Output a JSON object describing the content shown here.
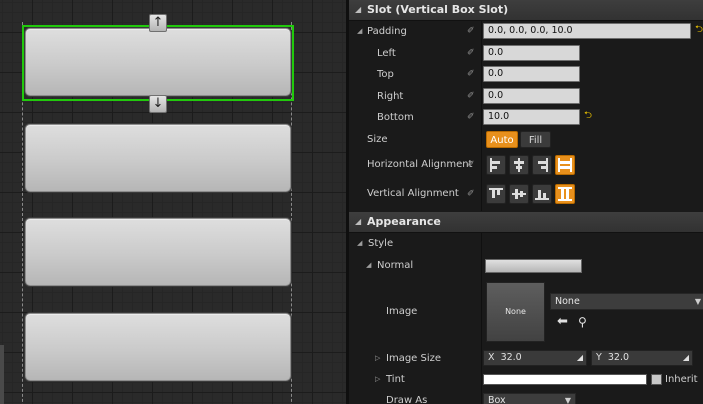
{
  "canvas": {
    "handles": {
      "top": "↑",
      "bottom": "↓"
    },
    "button_count": 4
  },
  "slot": {
    "header": "Slot (Vertical Box Slot)",
    "padding": {
      "label": "Padding",
      "value": "0.0, 0.0, 0.0, 10.0",
      "left_label": "Left",
      "left": "0.0",
      "top_label": "Top",
      "top": "0.0",
      "right_label": "Right",
      "right": "0.0",
      "bottom_label": "Bottom",
      "bottom": "10.0"
    },
    "size": {
      "label": "Size",
      "auto": "Auto",
      "fill": "Fill"
    },
    "horizontal_alignment": {
      "label": "Horizontal Alignment"
    },
    "vertical_alignment": {
      "label": "Vertical Alignment"
    }
  },
  "appearance": {
    "header": "Appearance",
    "style_label": "Style",
    "normal_label": "Normal",
    "image_label": "Image",
    "image_thumb": "None",
    "image_value": "None",
    "image_size": {
      "label": "Image Size",
      "x_label": "X",
      "x": "32.0",
      "y_label": "Y",
      "y": "32.0"
    },
    "tint": {
      "label": "Tint",
      "inherit": "Inherit"
    },
    "draw_as": {
      "label": "Draw As",
      "value": "Box"
    }
  },
  "colors": {
    "selection": "#21c90c",
    "accent": "#e8901c",
    "reset_arrow": "#e8c000"
  }
}
